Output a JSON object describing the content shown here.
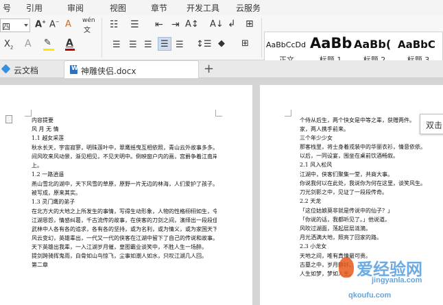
{
  "menu": {
    "items": [
      "号",
      "引用",
      "审阅",
      "视图",
      "章节",
      "开发工具",
      "云服务"
    ]
  },
  "ribbon": {
    "font_size": "四",
    "font_color": "#c00000",
    "highlight_color": "#ffe600",
    "styles": [
      {
        "sample": "AaBbCcDd",
        "name": "正文"
      },
      {
        "sample": "AaBb",
        "name": "标题 1"
      },
      {
        "sample": "AaBb(",
        "name": "标题 2"
      },
      {
        "sample": "AaBbC",
        "name": "标题 3"
      }
    ]
  },
  "tabs": {
    "cloud": "云文档",
    "doc": "神雕侠侣.docx"
  },
  "tooltip": "双击",
  "watermark": {
    "text": "爱经验网",
    "url": "jingyanla.com",
    "url2": "qkoufu.com"
  },
  "doc_left": {
    "title": "内容提要",
    "lines": [
      "风 月 无 情",
      "1.1  越女采莲",
      "秋水长天，宇宙寂寥，明珠莲叶中，翠鹰摇曳互相依照，青山云外故事多多。",
      "     间风吹来风动景，渐见相见，不见天明中。倒映窗户内的画，宫爵争着江南岸",
      "上。",
      "1.2   一路逍遥",
      "燕山雪北的湖中，天下风雪的草原，原野一片无边的林海，人们爱护了孩子。",
      "被写成，原来其实。",
      "1.3   灵门鹰的弟子",
      "在北方大的大地之上所发生的事情，写得生动形象，人物的性格栩栩如生，令人难忘。",
      "江湖恩怨，情感纠葛，千古流传的故事，在侠客的刀剑之间，演绎出一段段佳话。",
      "武林中人各有各的追求，各有各的坚持，或为名利，或为情义，或为家国天下。",
      "风云变幻，英雄辈出，一代又一代的侠客在江湖中留下了自己的传说和故事。",
      "天下英雄出我辈，一入江湖岁月催，皇图霸业谈笑中，不胜人生一场醉。",
      "提剑跨骑挥鬼雨，白骨如山鸟惊飞，尘事如潮人如水，只叹江湖几人回。",
      "第二章"
    ]
  },
  "doc_right": {
    "lines": [
      "个侍从后生，两个快女是中等之辈，获赠两件。",
      "家，两人携手前来。",
      "三个年少少女",
      "那客栈里，将士身着戎装中的华丽衣衫，情意依依。",
      "以后，一同设宴，围坐在桌前饮酒畅叙。",
      "2.1   风入松风",
      "江湖中，侠客们聚集一堂，共商大事。",
      "你说我何以在此处，我说你为何在这里，谈笑风生。",
      "刀光剑影之中，见证了一段段传奇。",
      "2.2   天龙",
      "「这位姑娘莫非就是传说中的仙子？」",
      "「你说的话，我都听见了。」他说道。",
      "风吹过湖面，荡起层层涟漪。",
      "月光洒满大地，照亮了回家的路。",
      "2.3   小龙女",
      "天地之间，唯有真情最可贵。",
      "古墓之中，岁月静好。",
      "人生如梦，梦如人生。"
    ]
  }
}
